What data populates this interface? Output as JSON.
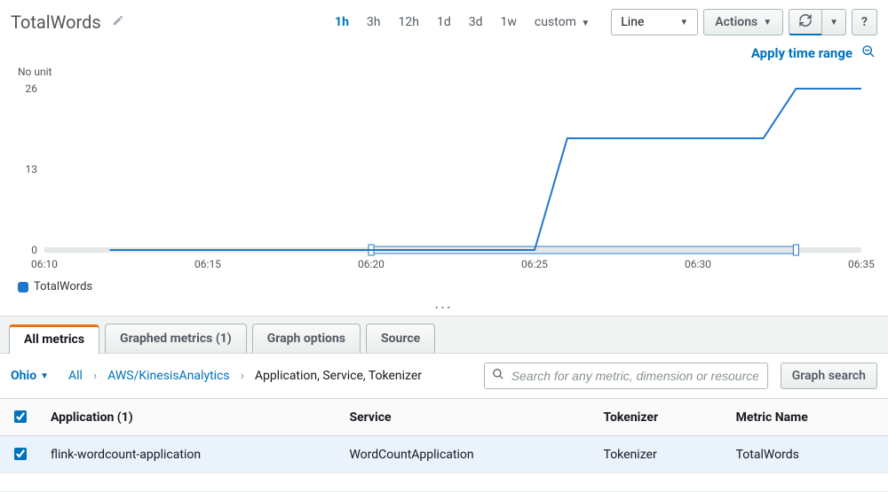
{
  "header": {
    "title": "TotalWords",
    "time_ranges": [
      "1h",
      "3h",
      "12h",
      "1d",
      "3d",
      "1w",
      "custom"
    ],
    "active_range": "1h",
    "chart_type_selected": "Line",
    "actions_label": "Actions",
    "apply_label": "Apply time range"
  },
  "chart": {
    "unit_label": "No unit",
    "legend": "TotalWords"
  },
  "chart_data": {
    "type": "line",
    "ylabel": "No unit",
    "ylim": [
      0,
      26
    ],
    "y_ticks": [
      0,
      13,
      26
    ],
    "x_ticks": [
      "06:10",
      "06:15",
      "06:20",
      "06:25",
      "06:30",
      "06:35"
    ],
    "brush": {
      "start_label": "06:20",
      "end_label": "06:33"
    },
    "series": [
      {
        "name": "TotalWords",
        "color": "#1f77d0",
        "points": [
          {
            "x": "06:12",
            "y": 0
          },
          {
            "x": "06:13",
            "y": 0
          },
          {
            "x": "06:14",
            "y": 0
          },
          {
            "x": "06:15",
            "y": 0
          },
          {
            "x": "06:16",
            "y": 0
          },
          {
            "x": "06:17",
            "y": 0
          },
          {
            "x": "06:18",
            "y": 0
          },
          {
            "x": "06:19",
            "y": 0
          },
          {
            "x": "06:20",
            "y": 0
          },
          {
            "x": "06:21",
            "y": 0
          },
          {
            "x": "06:22",
            "y": 0
          },
          {
            "x": "06:23",
            "y": 0
          },
          {
            "x": "06:24",
            "y": 0
          },
          {
            "x": "06:25",
            "y": 0
          },
          {
            "x": "06:26",
            "y": 18
          },
          {
            "x": "06:27",
            "y": 18
          },
          {
            "x": "06:28",
            "y": 18
          },
          {
            "x": "06:29",
            "y": 18
          },
          {
            "x": "06:30",
            "y": 18
          },
          {
            "x": "06:31",
            "y": 18
          },
          {
            "x": "06:32",
            "y": 18
          },
          {
            "x": "06:33",
            "y": 26
          },
          {
            "x": "06:34",
            "y": 26
          },
          {
            "x": "06:35",
            "y": 26
          }
        ]
      }
    ]
  },
  "tabs": {
    "items": [
      {
        "label": "All metrics"
      },
      {
        "label": "Graphed metrics (1)"
      },
      {
        "label": "Graph options"
      },
      {
        "label": "Source"
      }
    ],
    "active_index": 0
  },
  "filter": {
    "region": "Ohio",
    "crumbs": [
      "All",
      "AWS/KinesisAnalytics",
      "Application, Service, Tokenizer"
    ],
    "search_placeholder": "Search for any metric, dimension or resource id",
    "graph_search_label": "Graph search"
  },
  "table": {
    "columns": [
      "Application (1)",
      "Service",
      "Tokenizer",
      "Metric Name"
    ],
    "rows": [
      {
        "selected": true,
        "application": "flink-wordcount-application",
        "service": "WordCountApplication",
        "tokenizer": "Tokenizer",
        "metric": "TotalWords"
      }
    ]
  }
}
